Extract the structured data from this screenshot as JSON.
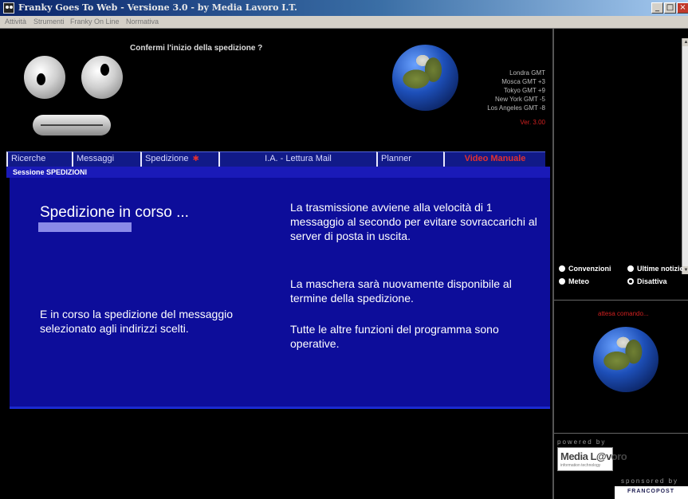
{
  "window": {
    "title": "Franky Goes To Web - Versione 3.0 - by Media Lavoro I.T.",
    "buttons": {
      "minimize": "_",
      "maximize": "□",
      "close": "×"
    }
  },
  "menu": [
    "Attività",
    "Strumenti",
    "Franky On Line",
    "Normativa"
  ],
  "banner": {
    "question": "Confermi l'inizio della spedizione ?",
    "timezones": [
      "Londra GMT",
      "Mosca GMT +3",
      "Tokyo GMT +9",
      "New York GMT -5",
      "Los Angeles GMT -8"
    ],
    "version": "Ver. 3.00"
  },
  "tabs": {
    "ricerche": "Ricerche",
    "messaggi": "Messaggi",
    "spedizione": "Spedizione",
    "spedizione_mark": "✱",
    "lettura_mail": "I.A. - Lettura Mail",
    "planner": "Planner",
    "video_manuale": "Video Manuale"
  },
  "session": {
    "header": "Sessione SPEDIZIONI"
  },
  "main": {
    "progress_title": "Spedizione in corso ...",
    "progress_fraction": 0.68,
    "info_speed": "La trasmissione avviene alla velocità di 1 messaggio al secondo per evitare sovraccarichi al server di posta in uscita.",
    "info_available": "La maschera sarà nuovamente disponibile al termine della spedizione.",
    "info_other": "Tutte le altre funzioni del programma sono operative.",
    "info_inprogress": "E in corso la spedizione del messaggio selezionato agli indirizzi scelti."
  },
  "side": {
    "options": {
      "convenzioni": "Convenzioni",
      "ultime_notizie": "Ultime notizie",
      "meteo": "Meteo",
      "disattiva": "Disattiva",
      "selected": "disattiva"
    },
    "waiting": "attesa comando...",
    "powered_by": "powered by",
    "media_logo": "Media L@voro",
    "media_logo_sub": "information technology",
    "sponsored_by": "sponsored by",
    "sponsor_logo": "FRANCOPOST"
  },
  "colors": {
    "panel_blue": "#0d0d9a",
    "tab_blue": "#111a88",
    "accent_red": "#e03030",
    "progress_fill": "#8a8ae8"
  }
}
